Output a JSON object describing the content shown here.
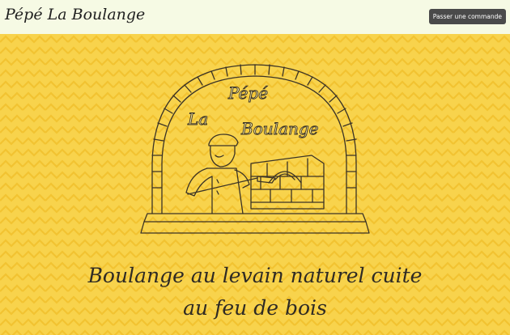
{
  "header": {
    "brand": "Pépé La Boulange",
    "order_button": "Passer une commande"
  },
  "hero": {
    "logo": {
      "name": "baker-oven-logo",
      "lettering": [
        "Pépé",
        "La",
        "Boulange"
      ]
    },
    "tagline_line1": "Boulange au levain naturel cuite",
    "tagline_line2": "au feu de bois"
  },
  "colors": {
    "hero_background": "#f8d34c",
    "hero_pattern": "#f2c331",
    "header_background": "#f6fae4",
    "button_background": "#4a4a4a",
    "ink": "#2e2a24"
  }
}
